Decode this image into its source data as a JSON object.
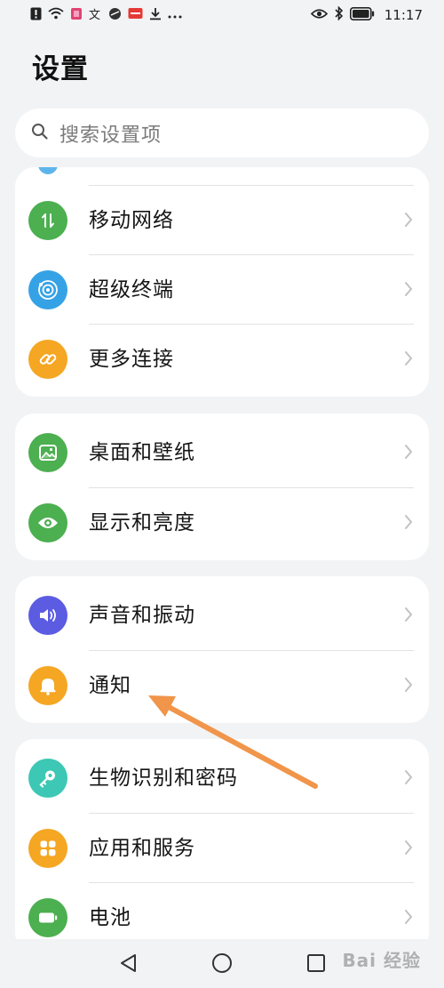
{
  "status_bar": {
    "time": "11:17",
    "left_icons": [
      "alert-icon",
      "wifi-icon",
      "app-icon",
      "app-icon",
      "app-icon",
      "app-icon",
      "download-icon",
      "more-icon"
    ],
    "right_icons": [
      "eye-icon",
      "bluetooth-icon",
      "battery-icon"
    ]
  },
  "header": {
    "title": "设置"
  },
  "search": {
    "placeholder": "搜索设置项"
  },
  "groups": [
    {
      "items": [
        {
          "label": "移动网络",
          "icon": "mobile-data-icon",
          "color": "#4caf50"
        },
        {
          "label": "超级终端",
          "icon": "super-device-icon",
          "color": "#36a2e6"
        },
        {
          "label": "更多连接",
          "icon": "link-icon",
          "color": "#f5a623"
        }
      ]
    },
    {
      "items": [
        {
          "label": "桌面和壁纸",
          "icon": "wallpaper-icon",
          "color": "#4caf50"
        },
        {
          "label": "显示和亮度",
          "icon": "eye-display-icon",
          "color": "#4caf50"
        }
      ]
    },
    {
      "items": [
        {
          "label": "声音和振动",
          "icon": "volume-icon",
          "color": "#5b5ce2"
        },
        {
          "label": "通知",
          "icon": "bell-icon",
          "color": "#f5a623"
        }
      ]
    },
    {
      "items": [
        {
          "label": "生物识别和密码",
          "icon": "key-icon",
          "color": "#3cc8b4"
        },
        {
          "label": "应用和服务",
          "icon": "apps-icon",
          "color": "#f5a623"
        },
        {
          "label": "电池",
          "icon": "battery-setting-icon",
          "color": "#4caf50"
        }
      ]
    }
  ],
  "nav": {
    "buttons": [
      "back-icon",
      "home-icon",
      "recents-icon"
    ]
  },
  "watermark": {
    "text": "Bai 经验"
  },
  "annotation": {
    "color": "#f0954a"
  }
}
